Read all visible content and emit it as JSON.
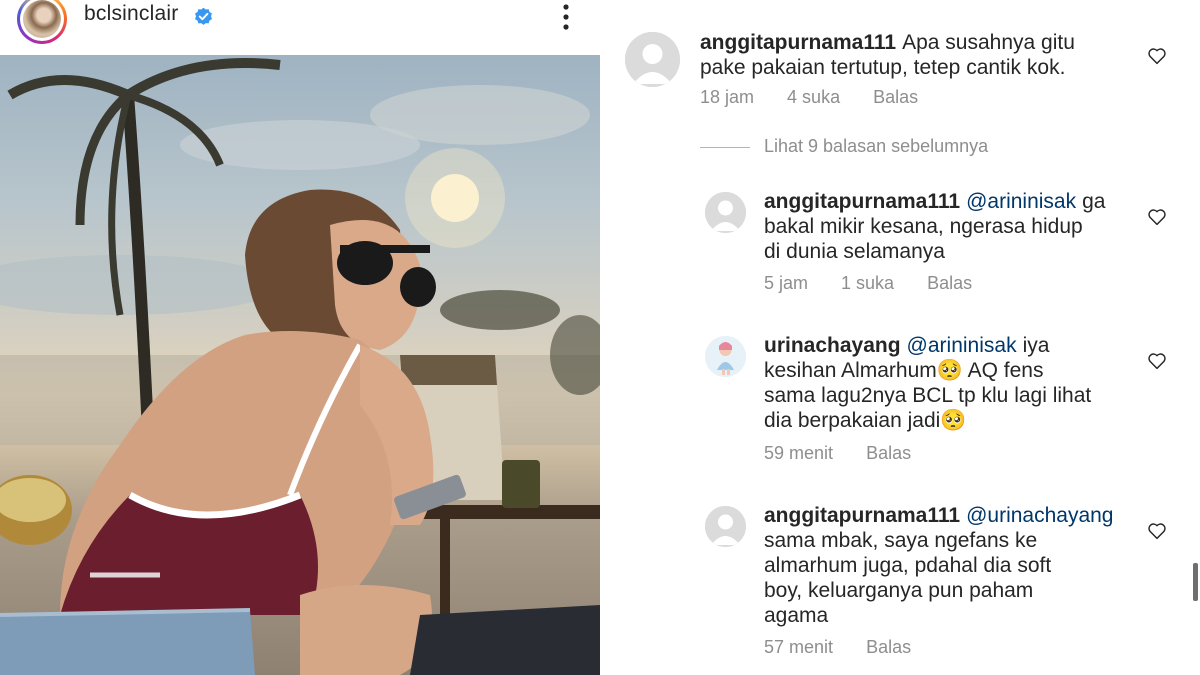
{
  "post": {
    "username": "bclsinclair",
    "verified": true,
    "more_icon": "more-vertical-icon",
    "photo_description_icon": "photo"
  },
  "colors": {
    "verified_blue": "#3897f0",
    "mention_blue": "#00376b",
    "meta_gray": "#8e8e8e"
  },
  "comments": [
    {
      "username": "anggitapurnama111",
      "mention": "",
      "lines": [
        "Apa susahnya gitu",
        "pake pakaian tertutup, tetep cantik kok."
      ],
      "time": "18 jam",
      "likes": "4 suka",
      "reply": "Balas"
    }
  ],
  "view_replies": "Lihat 9 balasan sebelumnya",
  "replies": [
    {
      "username": "anggitapurnama111",
      "mention": "@arininisak",
      "first_line_tail": "ga",
      "lines": [
        "bakal mikir kesana, ngerasa hidup",
        "di dunia selamanya"
      ],
      "time": "5 jam",
      "likes": "1 suka",
      "reply": "Balas"
    },
    {
      "username": "urinachayang",
      "mention": "@arininisak",
      "first_line_tail": "iya",
      "lines": [
        "kesihan Almarhum🥺 AQ fens",
        "sama lagu2nya BCL tp klu lagi lihat",
        "dia berpakaian jadi🥺"
      ],
      "time": "59 menit",
      "likes": "",
      "reply": "Balas"
    },
    {
      "username": "anggitapurnama111",
      "mention": "@urinachayang",
      "first_line_tail": "",
      "lines": [
        "sama mbak, saya ngefans ke",
        "almarhum juga, pdahal dia soft",
        "boy, keluarganya pun paham",
        "agama"
      ],
      "time": "57 menit",
      "likes": "",
      "reply": "Balas"
    }
  ]
}
